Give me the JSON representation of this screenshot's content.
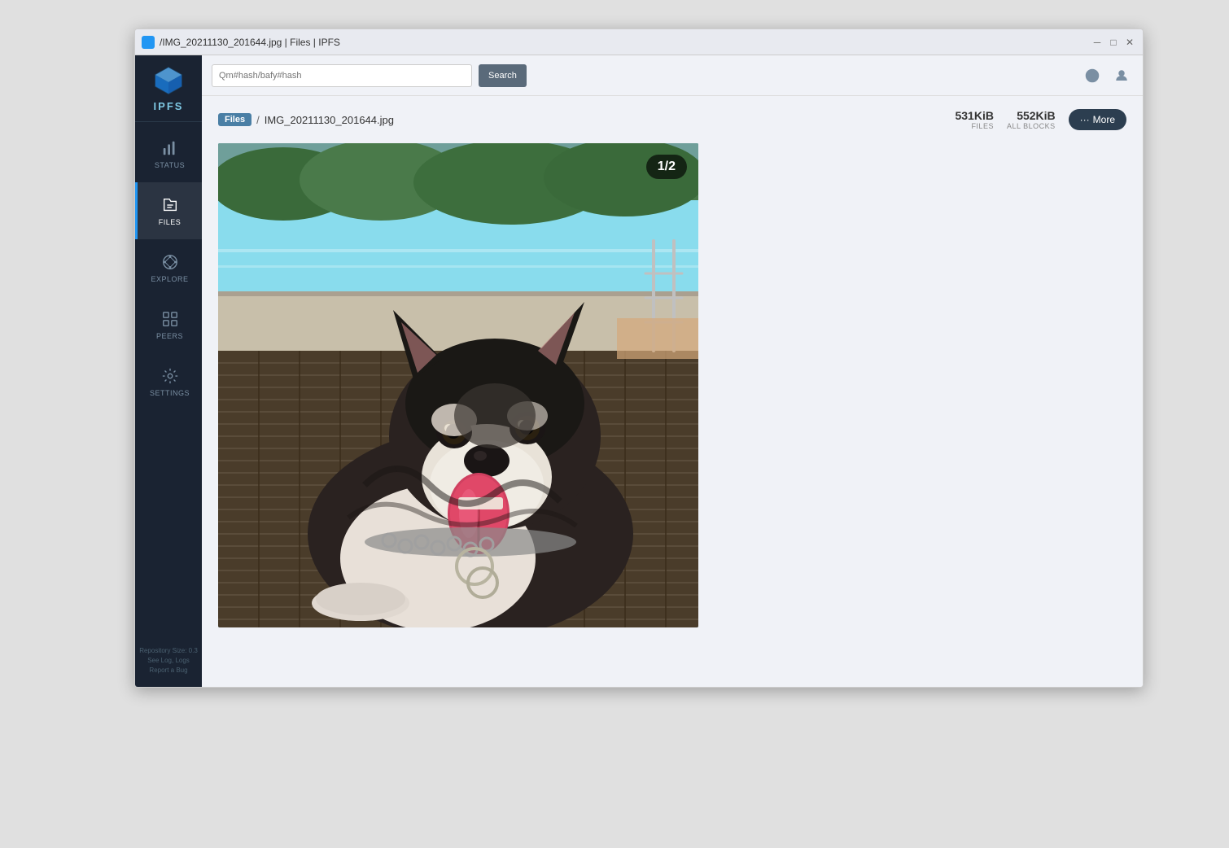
{
  "window": {
    "title": "/IMG_20211130_201644.jpg | Files | IPFS",
    "icon_alt": "IPFS"
  },
  "titlebar": {
    "title": "/IMG_20211130_201644.jpg | Files | IPFS"
  },
  "sidebar": {
    "logo_text": "IPFS",
    "items": [
      {
        "id": "status",
        "label": "STATUS",
        "active": false
      },
      {
        "id": "files",
        "label": "FILES",
        "active": true
      },
      {
        "id": "explore",
        "label": "EXPLORE",
        "active": false
      },
      {
        "id": "peers",
        "label": "PEERS",
        "active": false
      },
      {
        "id": "settings",
        "label": "SETTINGS",
        "active": false
      }
    ],
    "footer": {
      "line1": "Repository Size: 0.3",
      "line2": "See Log, Logs",
      "line3": "Report a Bug"
    }
  },
  "topbar": {
    "search_placeholder": "Qm#hash/bafy#hash",
    "search_btn_label": "Search",
    "help_icon": "?",
    "settings_icon": "⚙"
  },
  "breadcrumb": {
    "files_label": "Files",
    "separator": "/",
    "filename": "IMG_20211130_201644.jpg"
  },
  "stats": {
    "files_value": "531KiB",
    "files_label": "FILES",
    "blocks_value": "552KiB",
    "blocks_label": "ALL BLOCKS"
  },
  "more_btn": {
    "label": "More",
    "dots": "···"
  },
  "image": {
    "counter": "1/2",
    "alt": "Dog photo by pool"
  }
}
